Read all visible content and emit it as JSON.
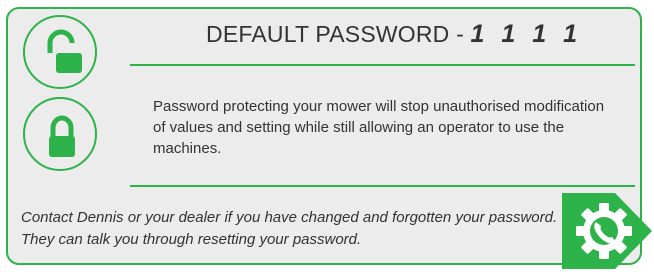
{
  "header": {
    "title": "DEFAULT PASSWORD - ",
    "code": "1 1 1 1"
  },
  "body": {
    "description": "Password protecting your mower will stop unauthorised modification of values and setting while still allowing an operator to use the machines."
  },
  "footer": {
    "contact": "Contact Dennis or your dealer if you have changed and forgotten your password. They can talk you through resetting your password."
  },
  "icons": {
    "top": "unlocked-padlock-icon",
    "bottom": "locked-padlock-icon",
    "contact": "phone-gear-icon"
  },
  "colors": {
    "accent": "#2eb24a",
    "panel": "#ececec",
    "text": "#333333"
  }
}
